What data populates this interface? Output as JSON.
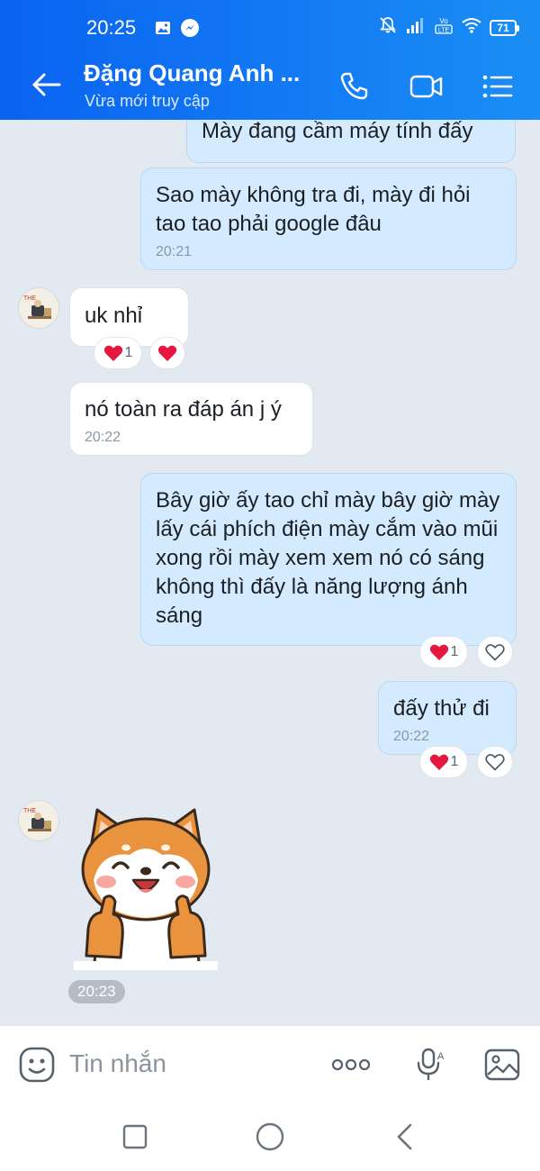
{
  "status_bar": {
    "time": "20:25",
    "battery": "71"
  },
  "header": {
    "contact_name": "Đặng Quang Anh ...",
    "contact_status": "Vừa mới truy cập"
  },
  "messages": [
    {
      "side": "me",
      "text": "Mày đang cầm máy tính đấy"
    },
    {
      "side": "me",
      "text": "Sao mày không tra đi, mày đi hỏi tao tao phải google đâu",
      "time": "20:21"
    },
    {
      "side": "them",
      "text": "uk nhỉ",
      "reaction_count": "1"
    },
    {
      "side": "them",
      "text": "nó toàn ra đáp án j ý",
      "time": "20:22"
    },
    {
      "side": "me",
      "text": "Bây giờ ấy tao chỉ mày bây giờ mày lấy cái phích điện mày cắm vào mũi xong rồi mày xem xem nó có sáng không thì đấy là năng lượng ánh sáng",
      "reaction_count": "1"
    },
    {
      "side": "me",
      "text": "đấy thử đi",
      "time": "20:22",
      "reaction_count": "1"
    },
    {
      "side": "them",
      "type": "sticker",
      "sticker": "shiba-dog-thumbs-up",
      "time": "20:23"
    }
  ],
  "input": {
    "placeholder": "Tin nhắn"
  },
  "colors": {
    "header_start": "#0a63f1",
    "header_end": "#1a8ef5",
    "my_bubble": "#d4ebff",
    "their_bubble": "#ffffff",
    "chat_bg": "#e2e9f1",
    "heart": "#e5173f"
  }
}
